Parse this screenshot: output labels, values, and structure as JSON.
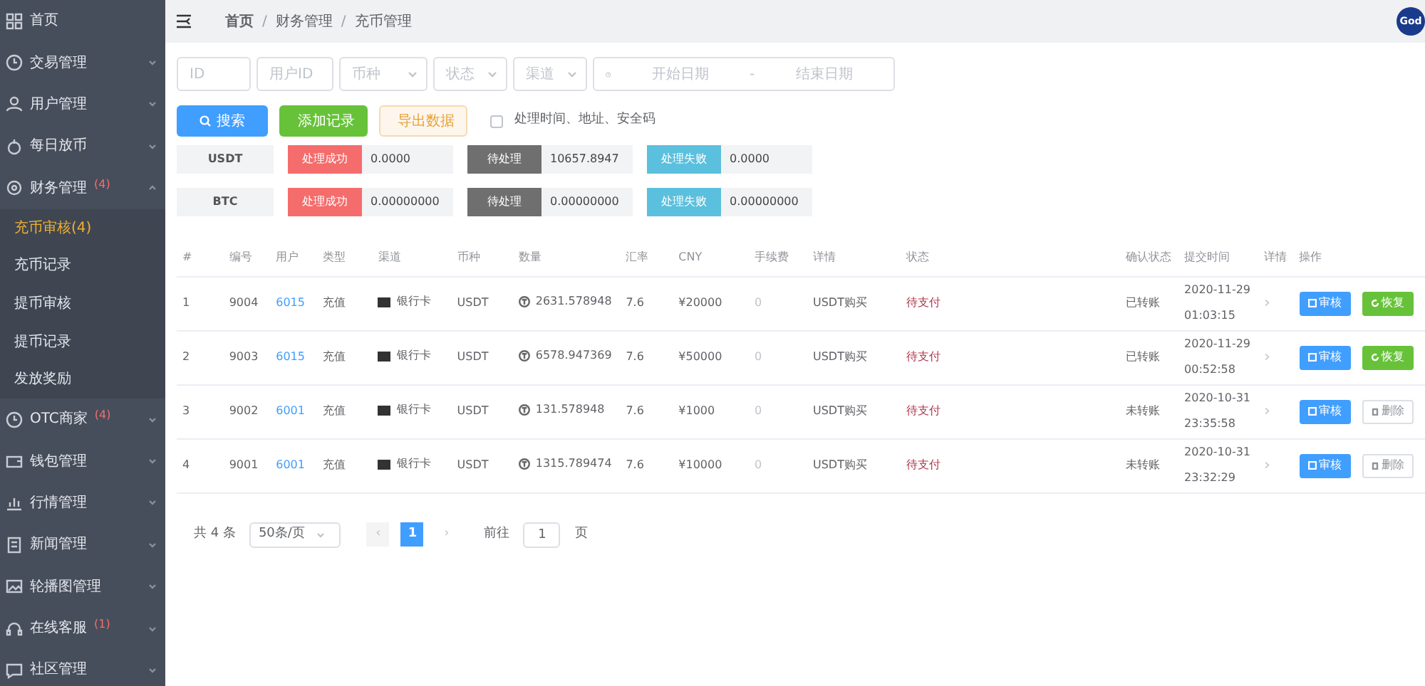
{
  "sidebar": {
    "items": [
      {
        "label": "首页"
      },
      {
        "label": "交易管理",
        "expanded": false
      },
      {
        "label": "用户管理",
        "expanded": false
      },
      {
        "label": "每日放币",
        "expanded": false
      },
      {
        "label": "财务管理",
        "badge": "(4)",
        "expanded": true,
        "children": [
          {
            "label": "充币审核(4)",
            "selected": true
          },
          {
            "label": "充币记录",
            "selected": false
          },
          {
            "label": "提币审核",
            "selected": false
          },
          {
            "label": "提币记录",
            "selected": false
          },
          {
            "label": "发放奖励",
            "selected": false
          }
        ]
      },
      {
        "label": "OTC商家",
        "badge": "(4)",
        "expanded": false
      },
      {
        "label": "钱包管理",
        "expanded": false
      },
      {
        "label": "行情管理",
        "expanded": false
      },
      {
        "label": "新闻管理",
        "expanded": false
      },
      {
        "label": "轮播图管理",
        "expanded": false
      },
      {
        "label": "在线客服",
        "badge": "(1)",
        "expanded": false
      },
      {
        "label": "社区管理",
        "expanded": false
      }
    ]
  },
  "header": {
    "breadcrumb": [
      {
        "label": "首页"
      },
      {
        "separator": "/",
        "label": "财务管理"
      },
      {
        "separator": "/",
        "label": "充币管理"
      }
    ],
    "avatar": "God"
  },
  "filters": [
    {
      "kind": "input",
      "placeholder": "ID"
    },
    {
      "kind": "input",
      "placeholder": "用户ID"
    },
    {
      "kind": "select",
      "placeholder": "币种"
    },
    {
      "kind": "select",
      "placeholder": "状态"
    },
    {
      "kind": "select",
      "placeholder": "渠道"
    }
  ],
  "date_range": {
    "start_placeholder": "开始日期",
    "separator": "-",
    "end_placeholder": "结束日期"
  },
  "actions": [
    {
      "kind": "search",
      "label": "搜索"
    },
    {
      "kind": "add",
      "label": "添加记录"
    },
    {
      "kind": "export",
      "label": "导出数据"
    }
  ],
  "option": {
    "label": "处理时间、地址、安全码",
    "checked": false
  },
  "summary": [
    {
      "coin": "USDT",
      "stats": [
        {
          "kind": "success",
          "label": "处理成功",
          "value": "0.0000"
        },
        {
          "kind": "pending",
          "label": "待处理",
          "value": "10657.8947"
        },
        {
          "kind": "failed",
          "label": "处理失败",
          "value": "0.0000"
        }
      ]
    },
    {
      "coin": "BTC",
      "stats": [
        {
          "kind": "success",
          "label": "处理成功",
          "value": "0.00000000"
        },
        {
          "kind": "pending",
          "label": "待处理",
          "value": "0.00000000"
        },
        {
          "kind": "failed",
          "label": "处理失败",
          "value": "0.00000000"
        }
      ]
    }
  ],
  "table": {
    "columns": [
      "#",
      "编号",
      "用户",
      "类型",
      "渠道",
      "币种",
      "数量",
      "汇率",
      "CNY",
      "手续费",
      "详情",
      "状态",
      "确认状态",
      "提交时间",
      "详情",
      "操作"
    ],
    "rows": [
      {
        "index": "1",
        "number": "9004",
        "user": "6015",
        "type": "充值",
        "channel": "银行卡",
        "coin": "USDT",
        "amount": "2631.578948",
        "rate": "7.6",
        "cny": "¥20000",
        "fee": "0",
        "detail": "USDT购买",
        "status": "待支付",
        "confirm": "已转账",
        "date": "2020-11-29",
        "time": "01:03:15",
        "expand": "›",
        "buttons": [
          {
            "kind": "review",
            "label": "审核"
          },
          {
            "kind": "restore",
            "label": "恢复"
          }
        ]
      },
      {
        "index": "2",
        "number": "9003",
        "user": "6015",
        "type": "充值",
        "channel": "银行卡",
        "coin": "USDT",
        "amount": "6578.947369",
        "rate": "7.6",
        "cny": "¥50000",
        "fee": "0",
        "detail": "USDT购买",
        "status": "待支付",
        "confirm": "已转账",
        "date": "2020-11-29",
        "time": "00:52:58",
        "expand": "›",
        "buttons": [
          {
            "kind": "review",
            "label": "审核"
          },
          {
            "kind": "restore",
            "label": "恢复"
          }
        ]
      },
      {
        "index": "3",
        "number": "9002",
        "user": "6001",
        "type": "充值",
        "channel": "银行卡",
        "coin": "USDT",
        "amount": "131.578948",
        "rate": "7.6",
        "cny": "¥1000",
        "fee": "0",
        "detail": "USDT购买",
        "status": "待支付",
        "confirm": "未转账",
        "date": "2020-10-31",
        "time": "23:35:58",
        "expand": "›",
        "buttons": [
          {
            "kind": "review",
            "label": "审核"
          },
          {
            "kind": "delete",
            "label": "删除"
          }
        ]
      },
      {
        "index": "4",
        "number": "9001",
        "user": "6001",
        "type": "充值",
        "channel": "银行卡",
        "coin": "USDT",
        "amount": "1315.789474",
        "rate": "7.6",
        "cny": "¥10000",
        "fee": "0",
        "detail": "USDT购买",
        "status": "待支付",
        "confirm": "未转账",
        "date": "2020-10-31",
        "time": "23:32:29",
        "expand": "›",
        "buttons": [
          {
            "kind": "review",
            "label": "审核"
          },
          {
            "kind": "delete",
            "label": "删除"
          }
        ]
      }
    ]
  },
  "pagination": {
    "total": "共 4 条",
    "page_size": "50条/页",
    "prev": "‹",
    "pages": [
      {
        "label": "1",
        "selected": true
      }
    ],
    "next": "›",
    "goto_label": "前往",
    "goto_value": "1",
    "goto_suffix": "页"
  }
}
